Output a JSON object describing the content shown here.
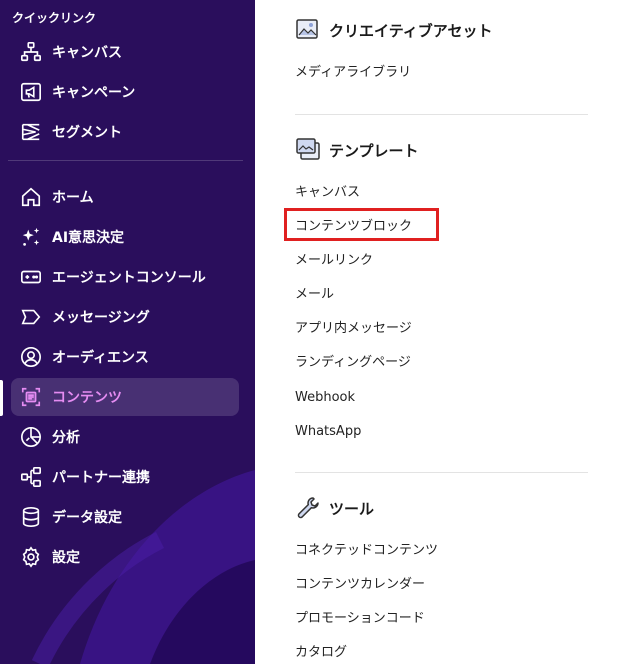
{
  "sidebar": {
    "quick_links_label": "クイックリンク",
    "quick_links": [
      {
        "label": "キャンバス",
        "icon": "canvas-icon"
      },
      {
        "label": "キャンペーン",
        "icon": "campaign-icon"
      },
      {
        "label": "セグメント",
        "icon": "segment-icon"
      }
    ],
    "nav": [
      {
        "label": "ホーム",
        "icon": "home-icon"
      },
      {
        "label": "AI意思決定",
        "icon": "sparkle-icon"
      },
      {
        "label": "エージェントコンソール",
        "icon": "agent-console-icon"
      },
      {
        "label": "メッセージング",
        "icon": "messaging-icon"
      },
      {
        "label": "オーディエンス",
        "icon": "audience-icon"
      },
      {
        "label": "コンテンツ",
        "icon": "content-icon",
        "active": true
      },
      {
        "label": "分析",
        "icon": "analytics-icon"
      },
      {
        "label": "パートナー連携",
        "icon": "partner-icon"
      },
      {
        "label": "データ設定",
        "icon": "database-icon"
      },
      {
        "label": "設定",
        "icon": "gear-icon"
      }
    ],
    "active_color": "#e58cf2",
    "bg_color": "#2a0e5c"
  },
  "main": {
    "sections": [
      {
        "title": "クリエイティブアセット",
        "icon": "image-icon",
        "links": [
          "メディアライブラリ"
        ]
      },
      {
        "title": "テンプレート",
        "icon": "templates-icon",
        "links": [
          "キャンバス",
          "コンテンツブロック",
          "メールリンク",
          "メール",
          "アプリ内メッセージ",
          "ランディングページ",
          "Webhook",
          "WhatsApp"
        ]
      },
      {
        "title": "ツール",
        "icon": "wrench-icon",
        "links": [
          "コネクテッドコンテンツ",
          "コンテンツカレンダー",
          "プロモーションコード",
          "カタログ"
        ]
      }
    ],
    "highlight_color": "#e02020"
  }
}
